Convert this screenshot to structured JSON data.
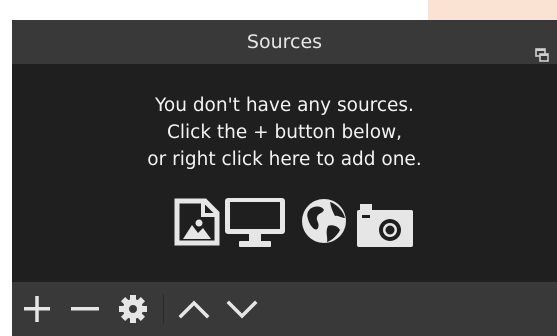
{
  "dock": {
    "title": "Sources",
    "float_icon": "float-dock-icon"
  },
  "empty_state": {
    "line1": "You don't have any sources.",
    "line2": "Click the + button below,",
    "line3": "or right click here to add one.",
    "icons": [
      "image-source-icon",
      "display-capture-icon",
      "browser-globe-icon",
      "camera-icon"
    ]
  },
  "toolbar": {
    "buttons": [
      {
        "name": "add-source-button",
        "icon": "plus-icon"
      },
      {
        "name": "remove-source-button",
        "icon": "minus-icon"
      },
      {
        "name": "source-properties-button",
        "icon": "gear-icon"
      },
      {
        "name": "move-source-up-button",
        "icon": "chevron-up-icon"
      },
      {
        "name": "move-source-down-button",
        "icon": "chevron-down-icon"
      }
    ]
  },
  "colors": {
    "panel_bg": "#1f1f1f",
    "bar_bg": "#393939",
    "text": "#f2f2f2",
    "icon": "#e6e6e6",
    "accent_strip": "#fbe3d3"
  }
}
